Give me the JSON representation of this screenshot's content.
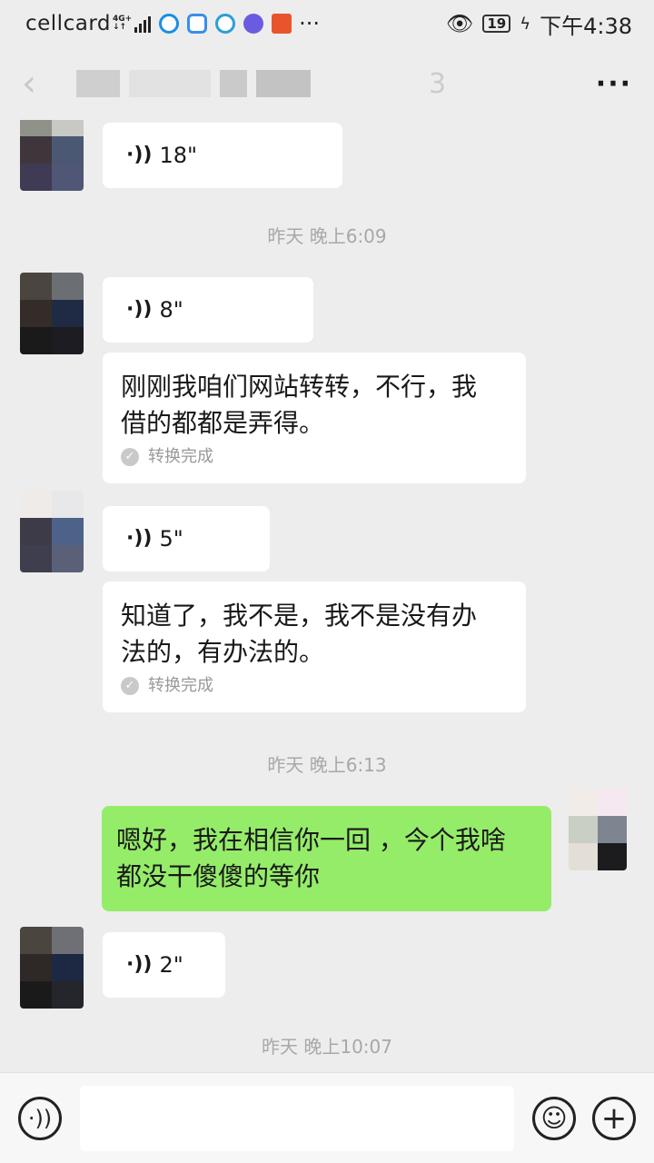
{
  "status_bar": {
    "carrier": "cellcard",
    "network": "4G+",
    "battery": "19",
    "time": "下午4:38"
  },
  "header": {
    "title_suffix": "3",
    "more_label": "···"
  },
  "messages": [
    {
      "type": "voice",
      "side": "left",
      "duration": "18\""
    },
    {
      "type": "timestamp",
      "text": "昨天 晚上6:09"
    },
    {
      "type": "voice",
      "side": "left",
      "duration": "8\""
    },
    {
      "type": "transcript",
      "side": "left",
      "text_line1": "刚刚我咱们网站转转，不行，我",
      "text_line2": "借的都都是弄得。",
      "status": "转换完成"
    },
    {
      "type": "voice",
      "side": "left",
      "duration": "5\""
    },
    {
      "type": "transcript",
      "side": "left",
      "text_line1": "知道了，我不是，我不是没有办",
      "text_line2": "法的，有办法的。",
      "status": "转换完成"
    },
    {
      "type": "timestamp",
      "text": "昨天 晚上6:13"
    },
    {
      "type": "text",
      "side": "right",
      "text_line1": "嗯好，我在相信你一回 ，今个我啥",
      "text_line2": "都没干傻傻的等你"
    },
    {
      "type": "voice",
      "side": "left",
      "duration": "2\""
    },
    {
      "type": "timestamp",
      "text": "昨天 晚上10:07"
    }
  ],
  "input_bar": {
    "voice_icon": "voice-input-icon",
    "emoji_icon": "emoji-icon",
    "plus_icon": "plus-icon"
  }
}
